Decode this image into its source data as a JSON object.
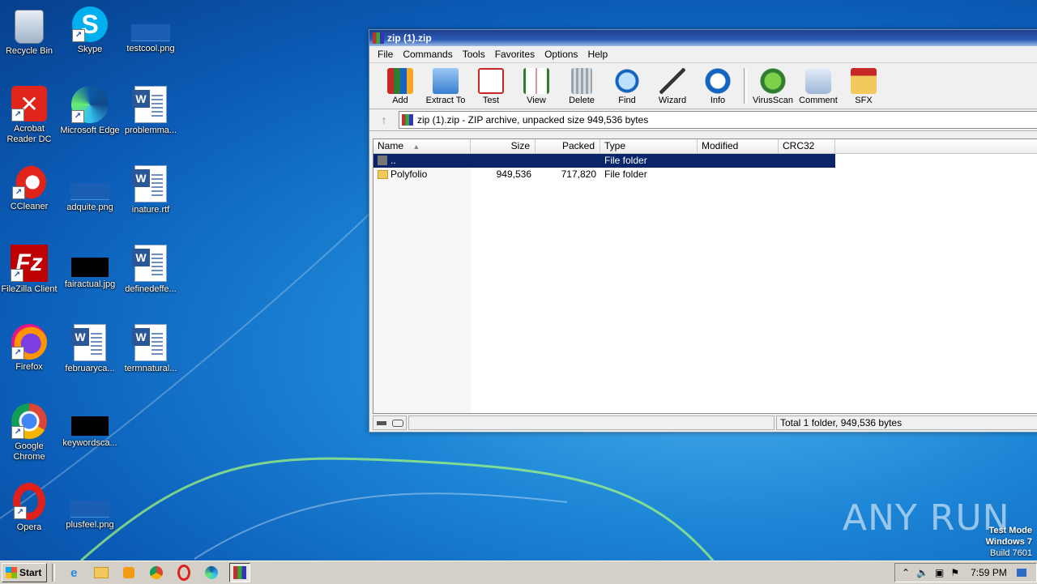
{
  "desktop": {
    "icons": [
      {
        "label": "Recycle Bin"
      },
      {
        "label": "Skype"
      },
      {
        "label": "testcool.png"
      },
      {
        "label": "Acrobat Reader DC"
      },
      {
        "label": "Microsoft Edge"
      },
      {
        "label": "problemma..."
      },
      {
        "label": "CCleaner"
      },
      {
        "label": "adquite.png"
      },
      {
        "label": "inature.rtf"
      },
      {
        "label": "FileZilla Client"
      },
      {
        "label": "fairactual.jpg"
      },
      {
        "label": "definedeffe..."
      },
      {
        "label": "Firefox"
      },
      {
        "label": "februaryca..."
      },
      {
        "label": "termnatural..."
      },
      {
        "label": "Google Chrome"
      },
      {
        "label": "keywordsca..."
      },
      {
        "label": "Opera"
      },
      {
        "label": "plusfeel.png"
      }
    ]
  },
  "window": {
    "title": "zip (1).zip",
    "menu": [
      "File",
      "Commands",
      "Tools",
      "Favorites",
      "Options",
      "Help"
    ],
    "toolbar": [
      "Add",
      "Extract To",
      "Test",
      "View",
      "Delete",
      "Find",
      "Wizard",
      "Info",
      "VirusScan",
      "Comment",
      "SFX"
    ],
    "address": "zip (1).zip - ZIP archive, unpacked size 949,536 bytes",
    "columns": [
      "Name",
      "Size",
      "Packed",
      "Type",
      "Modified",
      "CRC32"
    ],
    "rows": [
      {
        "name": "..",
        "size": "",
        "packed": "",
        "type": "File folder",
        "modified": "",
        "crc": ""
      },
      {
        "name": "Polyfolio",
        "size": "949,536",
        "packed": "717,820",
        "type": "File folder",
        "modified": "",
        "crc": ""
      }
    ],
    "status": "Total 1 folder, 949,536 bytes"
  },
  "taskbar": {
    "start_label": "Start",
    "clock": "7:59 PM"
  },
  "watermark": {
    "brand": "ANY RUN",
    "line1": "Test Mode",
    "line2": "Windows 7",
    "line3": "Build 7601"
  },
  "colors": {
    "selection": "#0a246a",
    "titlebar": "#2b5bb8"
  }
}
